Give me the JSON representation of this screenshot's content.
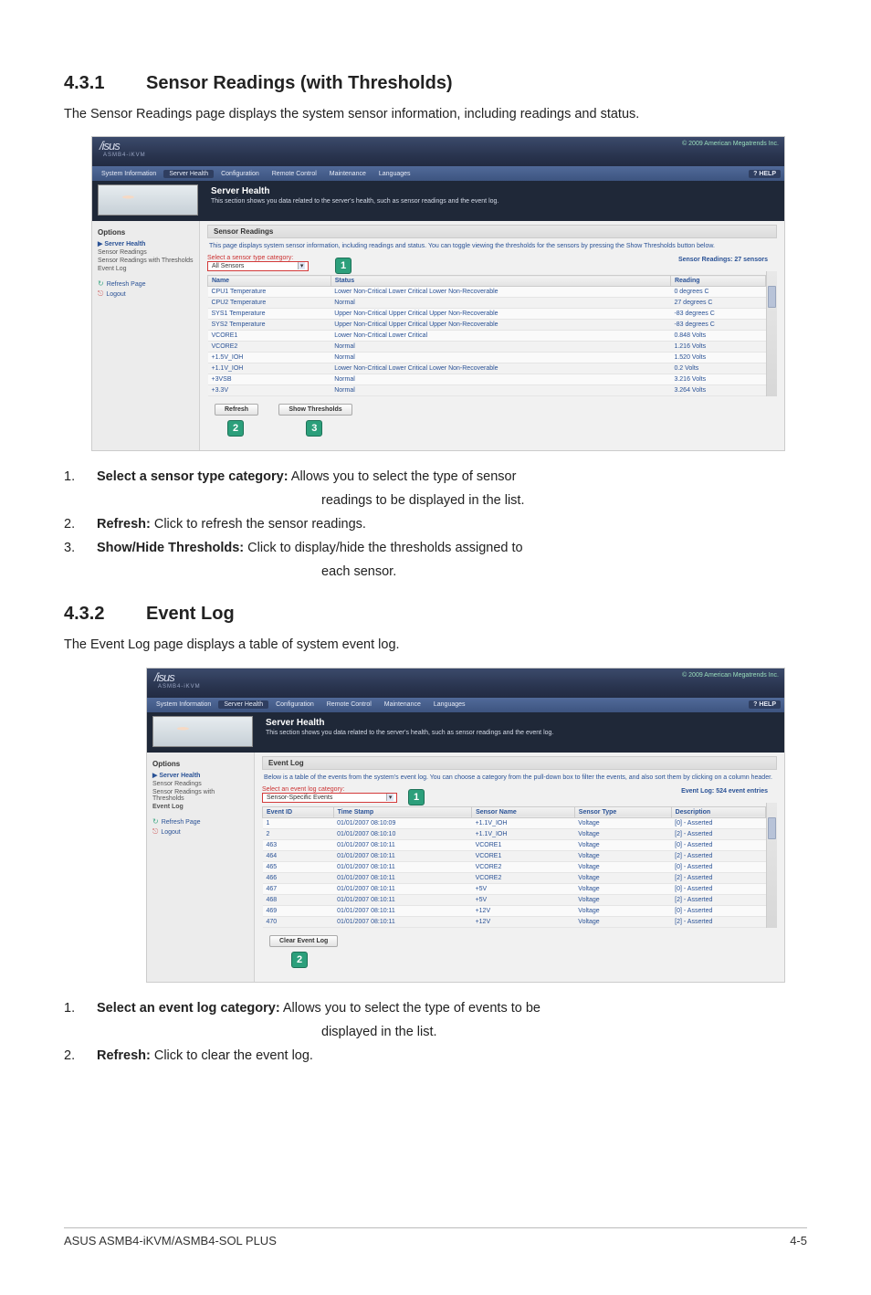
{
  "sec431": {
    "num": "4.3.1",
    "title": "Sensor Readings (with Thresholds)",
    "intro": "The Sensor Readings page displays the system sensor information, including readings and status.",
    "list": [
      {
        "n": "1.",
        "b": "Select a sensor type category:",
        "t": " Allows you to select the type of sensor",
        "cont": "readings to be displayed in the list."
      },
      {
        "n": "2.",
        "b": "Refresh:",
        "t": " Click to refresh the sensor readings."
      },
      {
        "n": "3.",
        "b": "Show/Hide Thresholds:",
        "t": " Click to display/hide the thresholds assigned to",
        "cont": "each sensor."
      }
    ]
  },
  "sec432": {
    "num": "4.3.2",
    "title": "Event Log",
    "intro": "The Event Log page displays a table of system event log.",
    "list": [
      {
        "n": "1.",
        "b": "Select an event log category:",
        "t": " Allows you to select the type of events to be",
        "cont": "displayed in the list."
      },
      {
        "n": "2.",
        "b": "Refresh:",
        "t": " Click to clear the event log."
      }
    ]
  },
  "ss_common": {
    "logo": "/isus",
    "logo_sub": "ASMB4-iKVM",
    "help": "? HELP",
    "menu": [
      "System Information",
      "Server Health",
      "Configuration",
      "Remote Control",
      "Maintenance",
      "Languages"
    ],
    "subhead_title": "Server Health",
    "subhead_desc": "This section shows you data related to the server's health, such as sensor readings and the event log.",
    "side": {
      "options": "Options",
      "server_health": "Server Health",
      "sensor_readings": "Sensor Readings",
      "sensor_readings_th": "Sensor Readings with Thresholds",
      "event_log": "Event Log",
      "refresh": "Refresh Page",
      "logout": "Logout"
    }
  },
  "ss1": {
    "panel_title": "Sensor Readings",
    "panel_desc": "This page displays system sensor information, including readings and status. You can toggle viewing the thresholds for the sensors by pressing the Show Thresholds button below.",
    "select_label": "Select a sensor type category:",
    "select_value": "All Sensors",
    "count_label": "Sensor Readings: 27 sensors",
    "headers": [
      "Name",
      "Status",
      "Reading"
    ],
    "rows": [
      [
        "CPU1 Temperature",
        "Lower Non-Critical Lower Critical Lower Non-Recoverable",
        "0 degrees C"
      ],
      [
        "CPU2 Temperature",
        "Normal",
        "27 degrees C"
      ],
      [
        "SYS1 Temperature",
        "Upper Non-Critical Upper Critical Upper Non-Recoverable",
        "-83 degrees C"
      ],
      [
        "SYS2 Temperature",
        "Upper Non-Critical Upper Critical Upper Non-Recoverable",
        "-83 degrees C"
      ],
      [
        "VCORE1",
        "Lower Non-Critical Lower Critical",
        "0.848 Volts"
      ],
      [
        "VCORE2",
        "Normal",
        "1.216 Volts"
      ],
      [
        "+1.5V_IOH",
        "Normal",
        "1.520 Volts"
      ],
      [
        "+1.1V_IOH",
        "Lower Non-Critical Lower Critical Lower Non-Recoverable",
        "0.2 Volts"
      ],
      [
        "+3VSB",
        "Normal",
        "3.216 Volts"
      ],
      [
        "+3.3V",
        "Normal",
        "3.264 Volts"
      ]
    ],
    "btn_refresh": "Refresh",
    "btn_show": "Show Thresholds"
  },
  "ss2": {
    "panel_title": "Event Log",
    "panel_desc": "Below is a table of the events from the system's event log. You can choose a category from the pull-down box to filter the events, and also sort them by clicking on a column header.",
    "select_label": "Select an event log category:",
    "select_value": "Sensor-Specific Events",
    "count_label": "Event Log: 524 event entries",
    "headers": [
      "Event ID",
      "Time Stamp",
      "Sensor Name",
      "Sensor Type",
      "Description"
    ],
    "rows": [
      [
        "1",
        "01/01/2007 08:10:09",
        "+1.1V_IOH",
        "Voltage",
        "[0] - Asserted"
      ],
      [
        "2",
        "01/01/2007 08:10:10",
        "+1.1V_IOH",
        "Voltage",
        "[2] - Asserted"
      ],
      [
        "463",
        "01/01/2007 08:10:11",
        "VCORE1",
        "Voltage",
        "[0] - Asserted"
      ],
      [
        "464",
        "01/01/2007 08:10:11",
        "VCORE1",
        "Voltage",
        "[2] - Asserted"
      ],
      [
        "465",
        "01/01/2007 08:10:11",
        "VCORE2",
        "Voltage",
        "[0] - Asserted"
      ],
      [
        "466",
        "01/01/2007 08:10:11",
        "VCORE2",
        "Voltage",
        "[2] - Asserted"
      ],
      [
        "467",
        "01/01/2007 08:10:11",
        "+5V",
        "Voltage",
        "[0] - Asserted"
      ],
      [
        "468",
        "01/01/2007 08:10:11",
        "+5V",
        "Voltage",
        "[2] - Asserted"
      ],
      [
        "469",
        "01/01/2007 08:10:11",
        "+12V",
        "Voltage",
        "[0] - Asserted"
      ],
      [
        "470",
        "01/01/2007 08:10:11",
        "+12V",
        "Voltage",
        "[2] - Asserted"
      ]
    ],
    "btn_clear": "Clear Event Log"
  },
  "footer": {
    "left": "ASUS ASMB4-iKVM/ASMB4-SOL PLUS",
    "right": "4-5"
  },
  "callouts": {
    "c1": "1",
    "c2": "2",
    "c3": "3"
  }
}
